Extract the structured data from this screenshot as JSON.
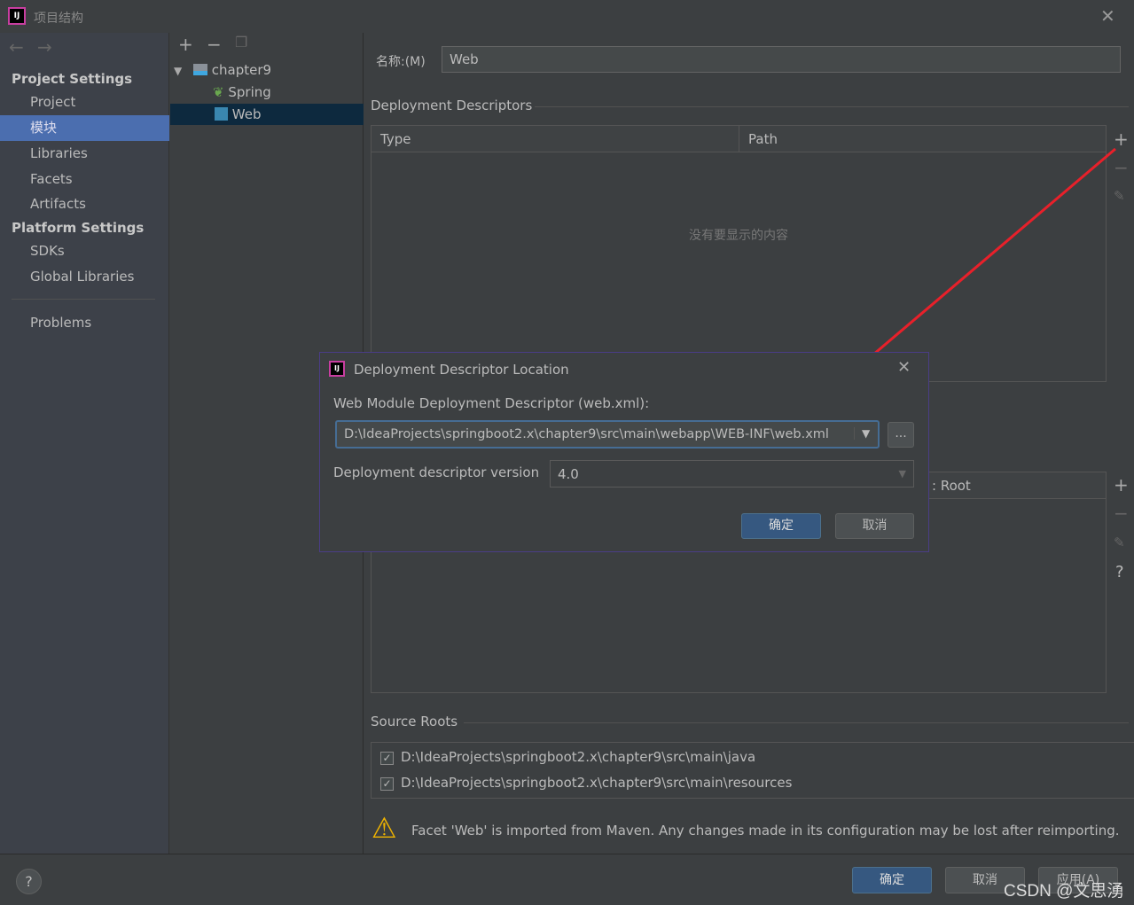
{
  "window": {
    "title": "项目结构",
    "close_icon": "close-icon"
  },
  "sidebar": {
    "section1": "Project Settings",
    "items1": [
      "Project",
      "模块",
      "Libraries",
      "Facets",
      "Artifacts"
    ],
    "section2": "Platform Settings",
    "items2": [
      "SDKs",
      "Global Libraries"
    ],
    "problems": "Problems",
    "selected": "模块"
  },
  "tree": {
    "nodes": [
      "chapter9",
      "Spring",
      "Web"
    ],
    "selected": "Web"
  },
  "main": {
    "name_label": "名称:(M)",
    "name_value": "Web",
    "dd_title": "Deployment Descriptors",
    "dd_columns": [
      "Type",
      "Path"
    ],
    "dd_empty": "没有要显示的内容",
    "root_col": ": Root",
    "source_roots_title": "Source Roots",
    "source_roots": [
      {
        "path": "D:\\IdeaProjects\\springboot2.x\\chapter9\\src\\main\\java",
        "checked": true
      },
      {
        "path": "D:\\IdeaProjects\\springboot2.x\\chapter9\\src\\main\\resources",
        "checked": true
      }
    ],
    "warning": "Facet 'Web' is imported from Maven. Any changes made in its configuration may be lost after reimporting."
  },
  "dialog": {
    "title": "Deployment Descriptor Location",
    "path_label": "Web Module Deployment Descriptor (web.xml):",
    "path_value": "D:\\IdeaProjects\\springboot2.x\\chapter9\\src\\main\\webapp\\WEB-INF\\web.xml",
    "browse": "...",
    "version_label": "Deployment descriptor version",
    "version_value": "4.0",
    "ok": "确定",
    "cancel": "取消"
  },
  "footer": {
    "ok": "确定",
    "cancel": "取消",
    "apply": "应用(A)",
    "help": "?"
  },
  "watermark": "CSDN @文思湧",
  "colors": {
    "accent": "#4b6eaf",
    "arrow": "#e8202a",
    "primary_button": "#365880"
  }
}
